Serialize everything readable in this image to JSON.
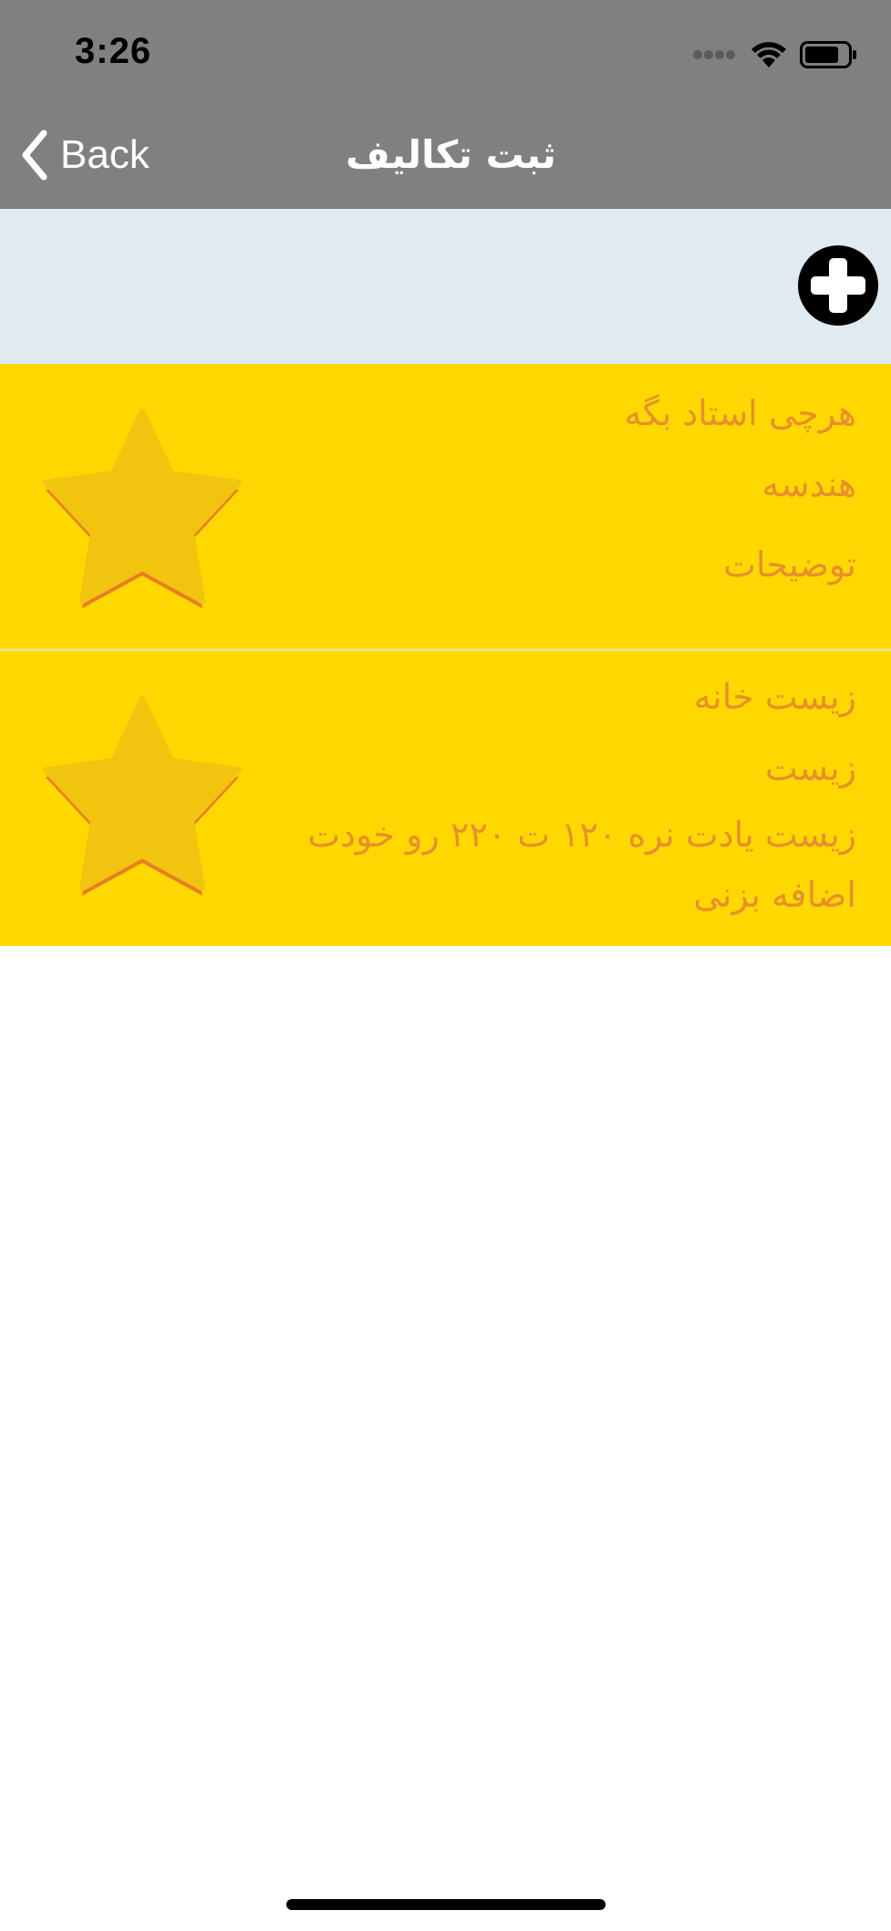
{
  "status_bar": {
    "time": "3:26"
  },
  "nav": {
    "back_label": "Back",
    "title": "ثبت تکالیف"
  },
  "toolbar": {
    "add_icon": "plus-circle-icon"
  },
  "tasks": [
    {
      "title": "هرچی استاد بگه",
      "subject": "هندسه",
      "description": "توضیحات",
      "starred_icon": "star-icon"
    },
    {
      "title": "زیست خانه",
      "subject": "زیست",
      "description": "زیست یادت نره ۱۲۰ ت ۲۲۰ رو خودت اضافه بزنی",
      "starred_icon": "star-icon"
    }
  ],
  "colors": {
    "nav_background": "#808080",
    "toolbar_background": "#e1e9f1",
    "row_background": "#ffd701",
    "text_accent": "#e7902b",
    "star_fill": "#f1c40f",
    "star_shadow": "#e67e22"
  }
}
